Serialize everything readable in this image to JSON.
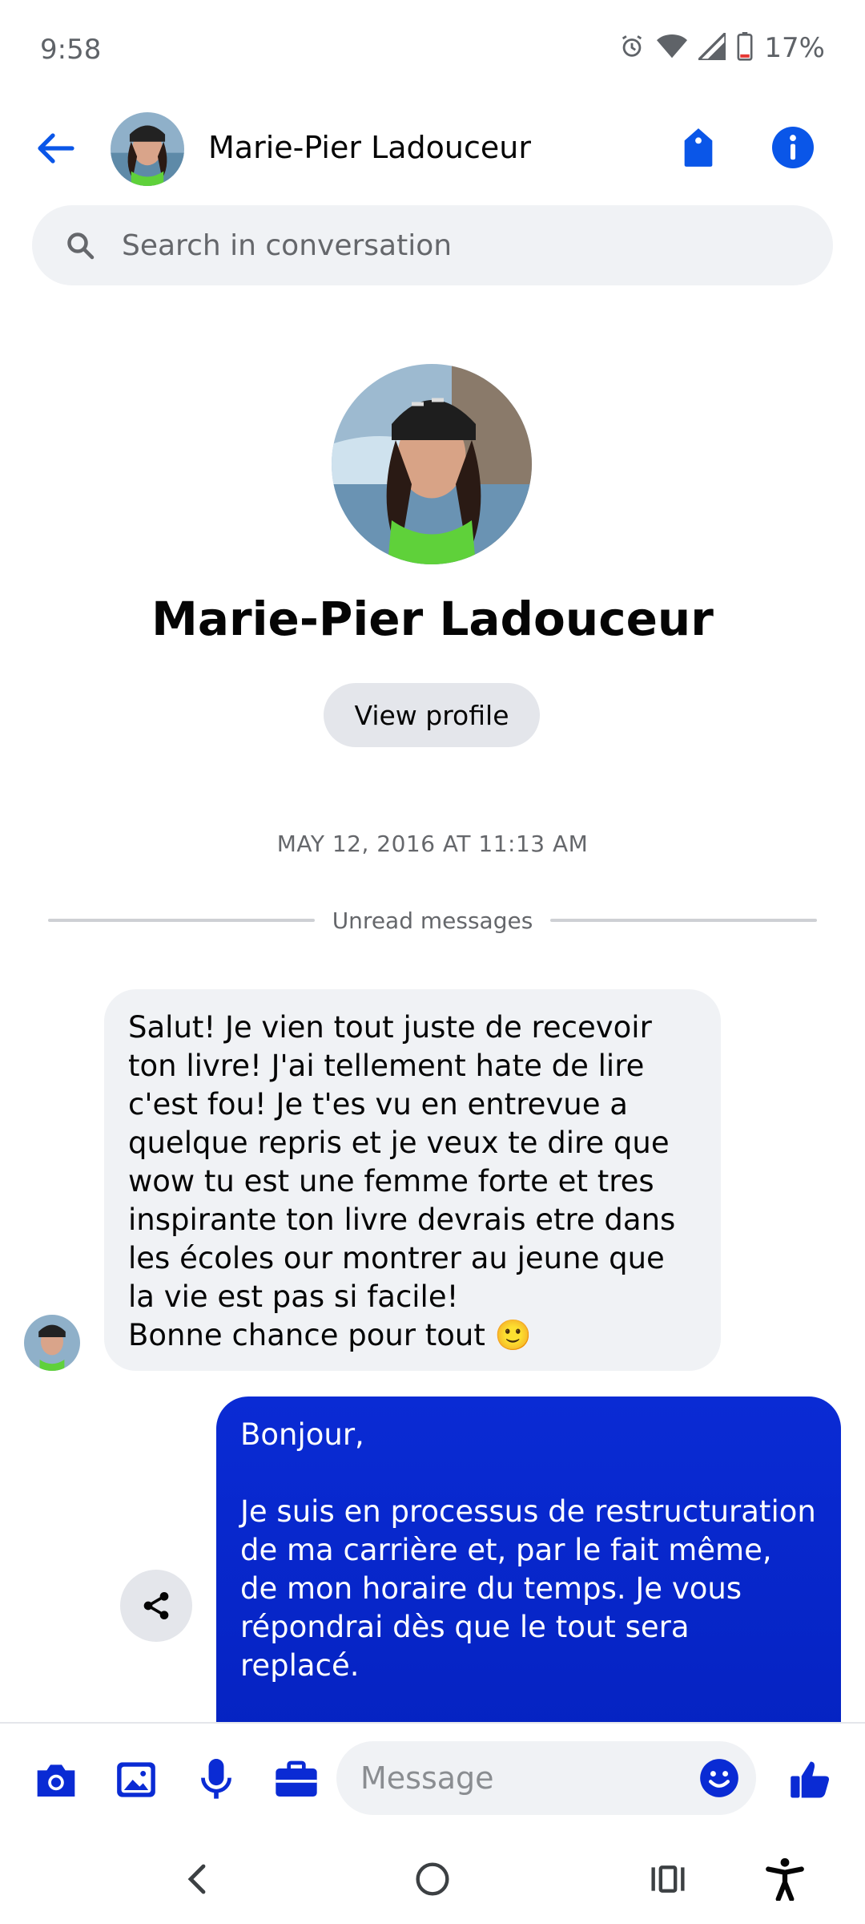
{
  "status_bar": {
    "time": "9:58",
    "battery": "17%"
  },
  "header": {
    "contact_name": "Marie-Pier Ladouceur"
  },
  "search": {
    "placeholder": "Search in conversation"
  },
  "profile": {
    "name": "Marie-Pier Ladouceur",
    "view_profile_label": "View profile"
  },
  "conversation": {
    "timestamp": "MAY 12, 2016 AT 11:13 AM",
    "unread_label": "Unread messages",
    "messages": [
      {
        "direction": "incoming",
        "text": "Salut! Je vien tout juste de recevoir ton livre! J'ai tellement hate de lire c'est fou! Je t'es vu en entrevue a quelque repris et je veux te dire que wow tu est une femme forte et tres inspirante ton livre devrais etre dans les écoles our montrer au jeune que la vie est pas si facile!\nBonne chance pour tout 🙂"
      },
      {
        "direction": "outgoing",
        "text": "Bonjour,\n\nJe suis en processus de restructuration de ma carrière et, par le fait même, de mon horaire du temps. Je vous répondrai dès que le tout sera replacé.\n\nSi c'est pour une urgence, envoyez-moi"
      }
    ]
  },
  "composer": {
    "placeholder": "Message"
  },
  "colors": {
    "accent": "#0a56e8",
    "outgoing_bubble": "#0a2bd4",
    "incoming_bubble": "#f0f2f5"
  }
}
